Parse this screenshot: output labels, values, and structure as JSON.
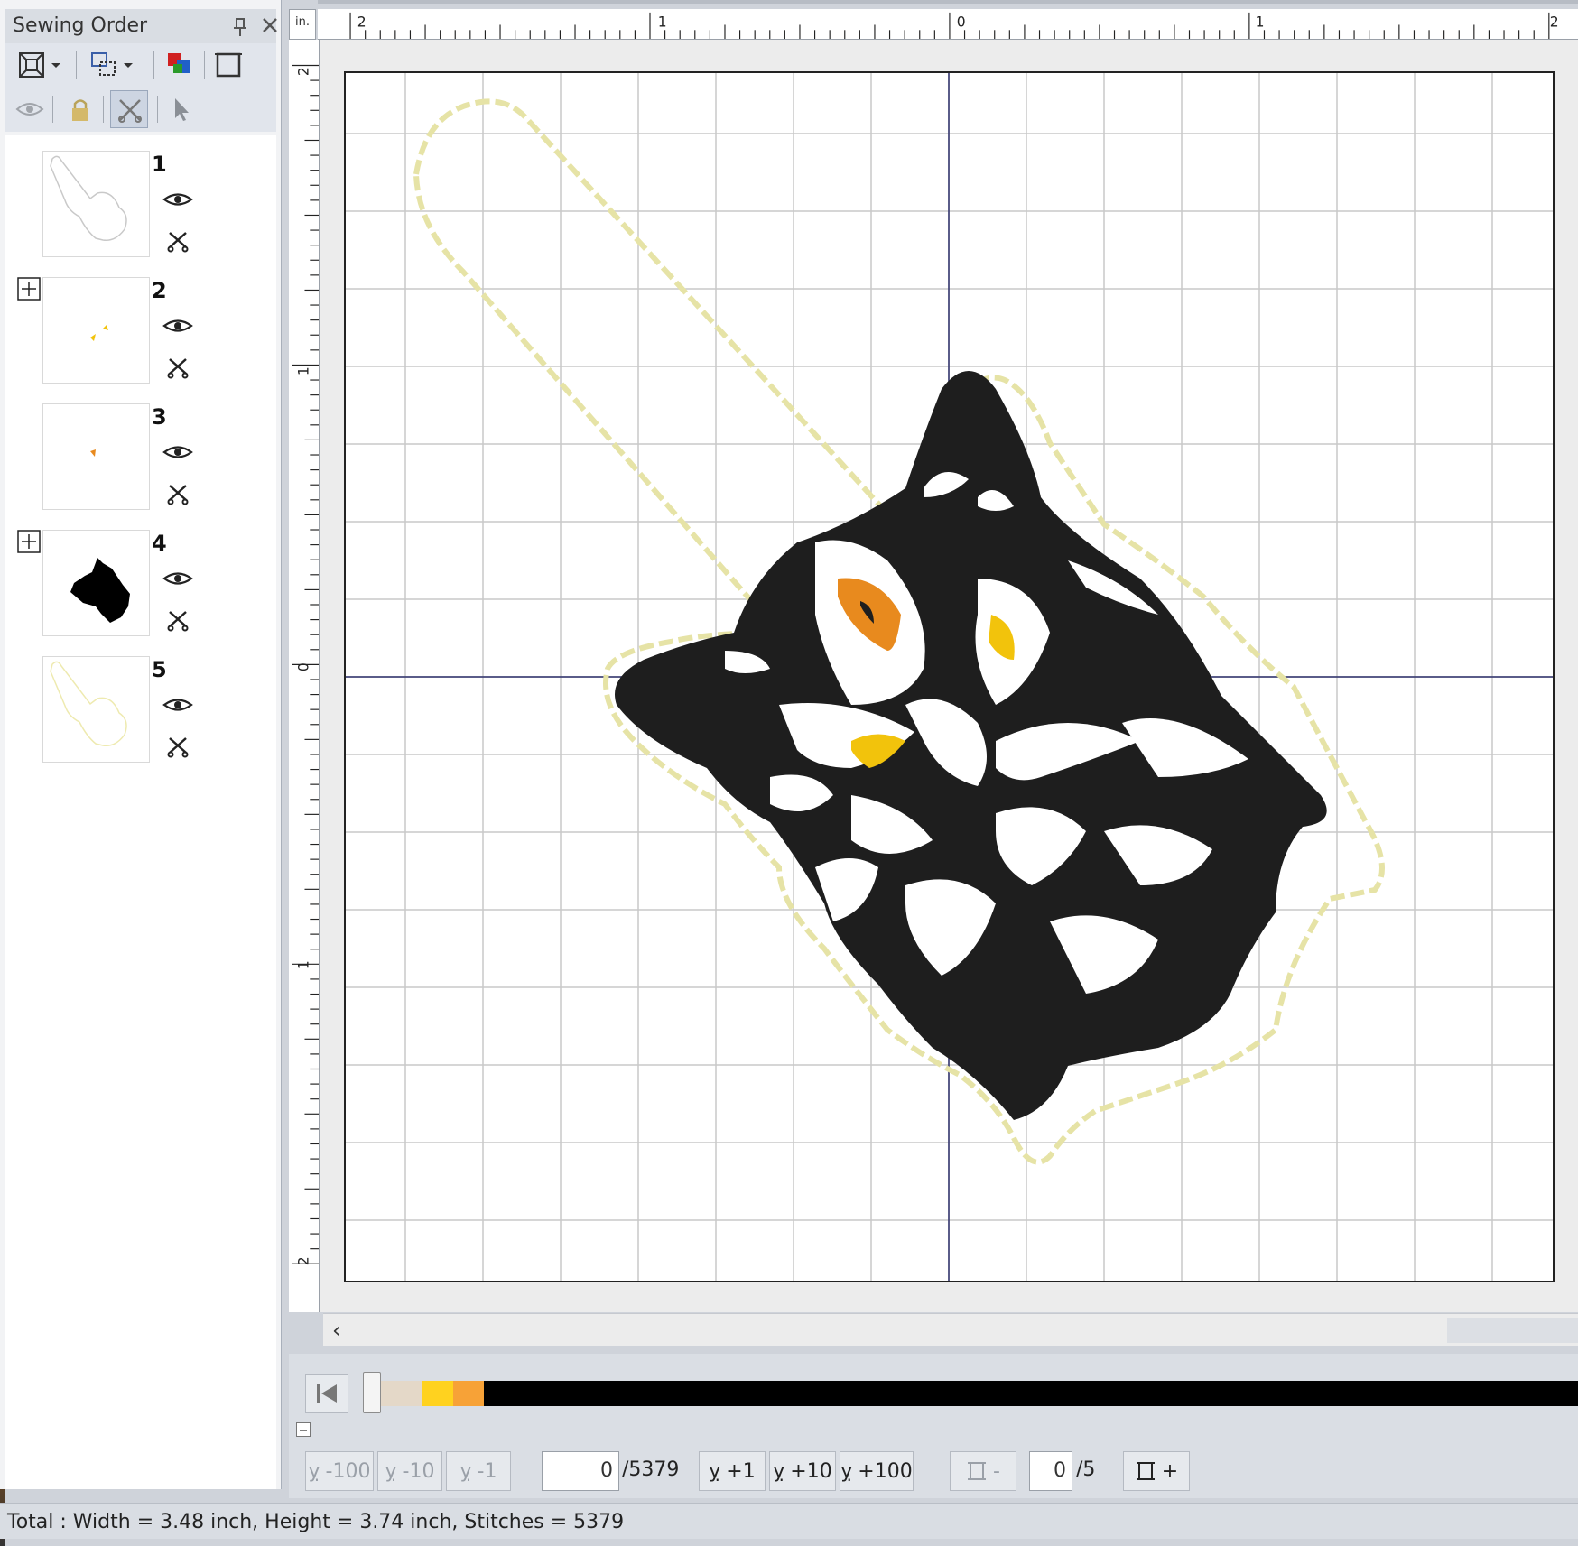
{
  "panel": {
    "title": "Sewing Order",
    "items": [
      {
        "number": "1",
        "expandable": false
      },
      {
        "number": "2",
        "expandable": true
      },
      {
        "number": "3",
        "expandable": false
      },
      {
        "number": "4",
        "expandable": true
      },
      {
        "number": "5",
        "expandable": false
      }
    ]
  },
  "ruler": {
    "unit": "in.",
    "h_labels": [
      "2",
      "1",
      "0",
      "1",
      "2"
    ],
    "v_labels": [
      "2",
      "1",
      "0",
      "1",
      "2"
    ]
  },
  "navigator": {
    "btn_m100": "-100",
    "btn_m10": "-10",
    "btn_m1": "-1",
    "stitch_value": "0",
    "stitch_total": "/5379",
    "btn_p1": "+1",
    "btn_p10": "+10",
    "btn_p100": "+100",
    "color_minus": "-",
    "color_value": "0",
    "color_total": "/5",
    "color_plus": "+",
    "thread_colors": [
      "#e4d8c8",
      "#ffd21f",
      "#f7a237",
      "#000000"
    ]
  },
  "status": {
    "text": "Total : Width = 3.48 inch, Height = 3.74 inch, Stitches = 5379"
  },
  "colors": {
    "outline_thread": "#e6e3a6",
    "black_thread": "#1e1e1e",
    "orange_eye": "#e88a1e",
    "yellow_eye": "#f2c30c",
    "grid": "#c9c9c9",
    "axis": "#2d2f6b"
  }
}
